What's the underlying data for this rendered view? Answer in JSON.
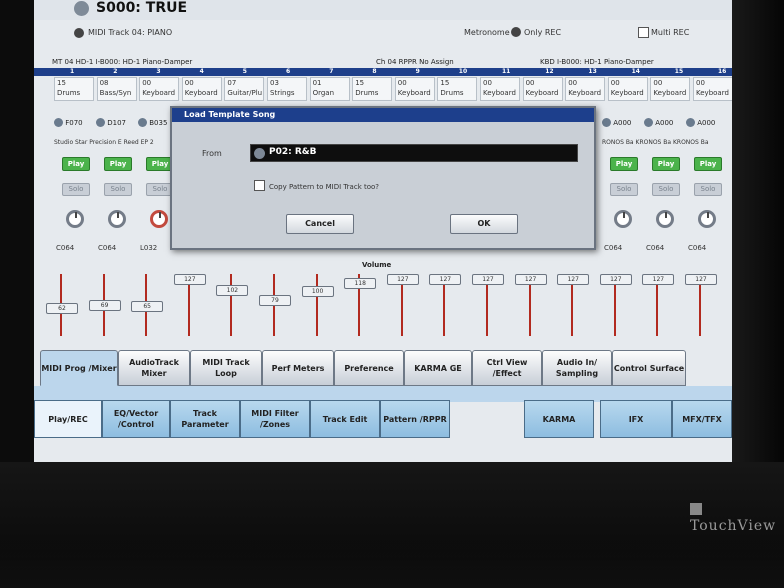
{
  "header": {
    "title": "S000: TRUE",
    "subtitle": "MIDI Track 04: PIANO",
    "metronome": "Metronome",
    "only_rec": "Only REC",
    "multi_rec": "Multi REC"
  },
  "track_header": {
    "left": "MT  04   HD-1   I-B000: HD-1 Piano-Damper",
    "ch": "Ch  04   RPPR   No Assign",
    "right": "KBD   I-B000: HD-1 Piano-Damper"
  },
  "channels": [
    "1",
    "2",
    "3",
    "4",
    "5",
    "6",
    "7",
    "8",
    "9",
    "10",
    "11",
    "12",
    "13",
    "14",
    "15",
    "16"
  ],
  "programs": [
    {
      "num": "15",
      "cat": "Drums"
    },
    {
      "num": "08",
      "cat": "Bass/Syn"
    },
    {
      "num": "00",
      "cat": "Keyboard"
    },
    {
      "num": "00",
      "cat": "Keyboard"
    },
    {
      "num": "07",
      "cat": "Guitar/Plu"
    },
    {
      "num": "03",
      "cat": "Strings"
    },
    {
      "num": "01",
      "cat": "Organ"
    },
    {
      "num": "15",
      "cat": "Drums"
    },
    {
      "num": "00",
      "cat": "Keyboard"
    },
    {
      "num": "15",
      "cat": "Drums"
    },
    {
      "num": "00",
      "cat": "Keyboard"
    },
    {
      "num": "00",
      "cat": "Keyboard"
    },
    {
      "num": "00",
      "cat": "Keyboard"
    },
    {
      "num": "00",
      "cat": "Keyboard"
    },
    {
      "num": "00",
      "cat": "Keyboard"
    },
    {
      "num": "00",
      "cat": "Keyboard"
    }
  ],
  "banks_left": [
    "F070",
    "D107",
    "B035"
  ],
  "banks_right": [
    "A000",
    "A000",
    "A000"
  ],
  "names_left": "Studio Star Precision E Reed EP 2",
  "names_right": "RONOS Ba KRONOS Ba KRONOS Ba",
  "play_label": "Play",
  "solo_label": "Solo",
  "pans_left": [
    "C064",
    "C064",
    "L032"
  ],
  "pans_right": [
    "C064",
    "C064",
    "C064"
  ],
  "volume_label": "Volume",
  "volumes": [
    62,
    69,
    65,
    127,
    102,
    79,
    100,
    118,
    127,
    127,
    127,
    127,
    127,
    127,
    127,
    127
  ],
  "dialog": {
    "title": "Load Template Song",
    "from_label": "From",
    "from_value": "P02: R&B",
    "copy_label": "Copy Pattern to MIDI Track too?",
    "cancel": "Cancel",
    "ok": "OK"
  },
  "tabs_upper": [
    "MIDI Prog /Mixer",
    "AudioTrack Mixer",
    "MIDI Track Loop",
    "Perf Meters",
    "Preference",
    "KARMA GE",
    "Ctrl View /Effect",
    "Audio In/ Sampling",
    "Control Surface"
  ],
  "tabs_lower": [
    "Play/REC",
    "EQ/Vector /Control",
    "Track Parameter",
    "MIDI Filter /Zones",
    "Track Edit",
    "Pattern /RPPR",
    "KARMA",
    "IFX",
    "MFX/TFX"
  ],
  "brand": "TouchView"
}
